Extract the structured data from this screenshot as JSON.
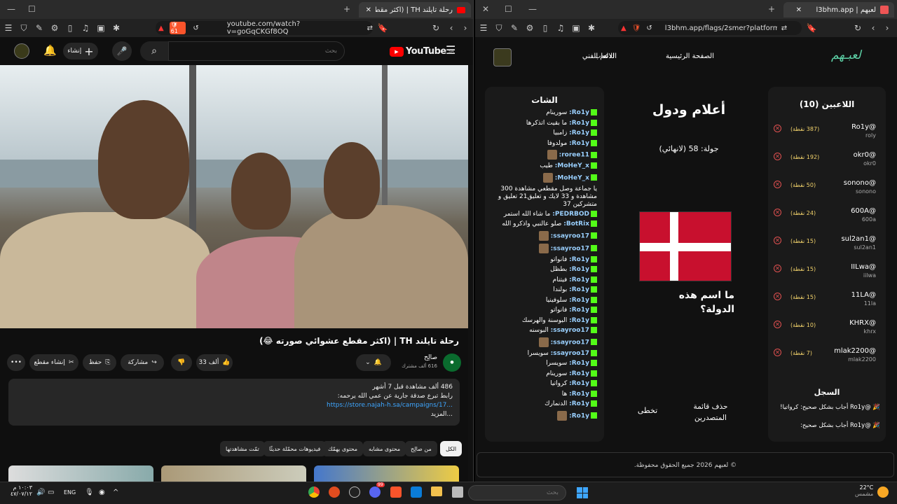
{
  "left_window": {
    "tab_title": "رحلة تايلند TH | (اكثر مقطع عشوائ",
    "url": "youtube.com/watch?v=goGqCKGf8OQ",
    "brave_badge": "61",
    "youtube": {
      "logo": "YouTube",
      "logo_region": "SA",
      "search_placeholder": "بحث",
      "create_label": "إنشاء",
      "video_title": "رحلة تايلند TH | (اكثر مقطع عشوائي صورته 😂)",
      "channel_name": "صالِح",
      "subscribers": "616 ألف مشترك",
      "like_count": "33 ألف",
      "share_label": "مشاركة",
      "save_label": "حفظ",
      "clip_label": "إنشاء مقطع",
      "desc_line1": "486 ألف مشاهدة قبل 7 أشهر",
      "desc_line2": "رابط تبرع صدقة جارية عن عمي الله يرحمه:",
      "desc_link": "https://store.najah-h.sa/campaigns/17...",
      "desc_more": "...المزيد",
      "chips": [
        "الكل",
        "من صالِح",
        "محتوى مشابه",
        "محتوى يهمّك",
        "فيديوهات محمّلة حديثًا",
        "تمّت مشاهدتها"
      ]
    }
  },
  "right_window": {
    "tab_title": "لعبهم | l3bhm.app",
    "url": "l3bhm.app/flags/2smer?platform=kick",
    "site": {
      "logo": "لعبـهم",
      "nav": [
        "الصفحة الرئيسية",
        "الالعاب",
        "الدعم الفني"
      ],
      "players_title": "اللاعبين (10)",
      "players": [
        {
          "name": "@Ro1y",
          "user": "roly",
          "points": "(387 نقطة)"
        },
        {
          "name": "@okr0",
          "user": "okr0",
          "points": "(192 نقطة)"
        },
        {
          "name": "@sonono",
          "user": "sonono",
          "points": "(50 نقطة)"
        },
        {
          "name": "@600A",
          "user": "600a",
          "points": "(24 نقطة)"
        },
        {
          "name": "@sul2an1",
          "user": "sul2an1",
          "points": "(15 نقطة)"
        },
        {
          "name": "@IILwa",
          "user": "iilwa",
          "points": "(15 نقطة)"
        },
        {
          "name": "@11LA",
          "user": "11la",
          "points": "(15 نقطة)"
        },
        {
          "name": "@KHRX",
          "user": "khrx",
          "points": "(10 نقطة)"
        },
        {
          "name": "@mlak2200",
          "user": "mlak2200",
          "points": "(7 نقطة)"
        }
      ],
      "log_title": "السجل",
      "log": [
        "🎉 @Ro1y أجاب بشكل صحيح: كرواتيا!",
        "🎉 @Ro1y أجاب بشكل صحيح:"
      ],
      "game_title": "أعلام ودول",
      "round": "جولة: 58 (لانهائي)",
      "question": "ما اسم هذه الدولة؟",
      "leaderboard_btn": "حذف قائمة المتصدرين",
      "skip_btn": "تخطى",
      "chat_title": "الشات",
      "chat": [
        {
          "user": "Ro1y:",
          "msg": "سورينام"
        },
        {
          "user": "Ro1y:",
          "msg": "ما بقيت اتذكرها"
        },
        {
          "user": "Ro1y:",
          "msg": "زامبيا"
        },
        {
          "user": "Ro1y:",
          "msg": "مولدوفا"
        },
        {
          "user": "roree11:",
          "msg": ""
        },
        {
          "user": "MoHeY_x:",
          "msg": "طيب"
        },
        {
          "user": "MoHeY_x:",
          "msg": ""
        },
        {
          "user": "",
          "msg": "يا جماعة وصل مقطعي مشاهدة 300 مشاهدة و 33 لايك و تعليق21 تعليق و متشركين 37"
        },
        {
          "user": "PEDRBOD:",
          "msg": "ما شاء الله استمر"
        },
        {
          "user": "BotRix:",
          "msg": "صلو عالنبي واذكرو الله"
        },
        {
          "user": "ssayroo17:",
          "msg": ""
        },
        {
          "user": "ssayroo17:",
          "msg": ""
        },
        {
          "user": "Ro1y:",
          "msg": "فانواتو"
        },
        {
          "user": "Ro1y:",
          "msg": "بطظل"
        },
        {
          "user": "Ro1y:",
          "msg": "فيتنام"
        },
        {
          "user": "Ro1y:",
          "msg": "بولندا"
        },
        {
          "user": "Ro1y:",
          "msg": "سلوفينيا"
        },
        {
          "user": "Ro1y:",
          "msg": "فانواتو"
        },
        {
          "user": "Ro1y:",
          "msg": "البوسنة والهرسك"
        },
        {
          "user": "ssayroo17:",
          "msg": "البوسنه"
        },
        {
          "user": "ssayroo17:",
          "msg": ""
        },
        {
          "user": "ssayroo17:",
          "msg": "سويسرا"
        },
        {
          "user": "Ro1y:",
          "msg": "سويسرا"
        },
        {
          "user": "Ro1y:",
          "msg": "سورينام"
        },
        {
          "user": "Ro1y:",
          "msg": "كرواتيا"
        },
        {
          "user": "Ro1y:",
          "msg": "ها"
        },
        {
          "user": "Ro1y:",
          "msg": "الدنمارك"
        },
        {
          "user": "Ro1y:",
          "msg": ""
        }
      ],
      "footer": "© لعبهم 2026 جميع الحقوق محفوظة."
    }
  },
  "taskbar": {
    "time": "١٠:٠٣ م",
    "date": "٤٧/٠٧/١٢",
    "lang": "ENG",
    "search_placeholder": "بحث",
    "weather_temp": "22°C",
    "weather_desc": "مشمس",
    "discord_badge": "99"
  }
}
